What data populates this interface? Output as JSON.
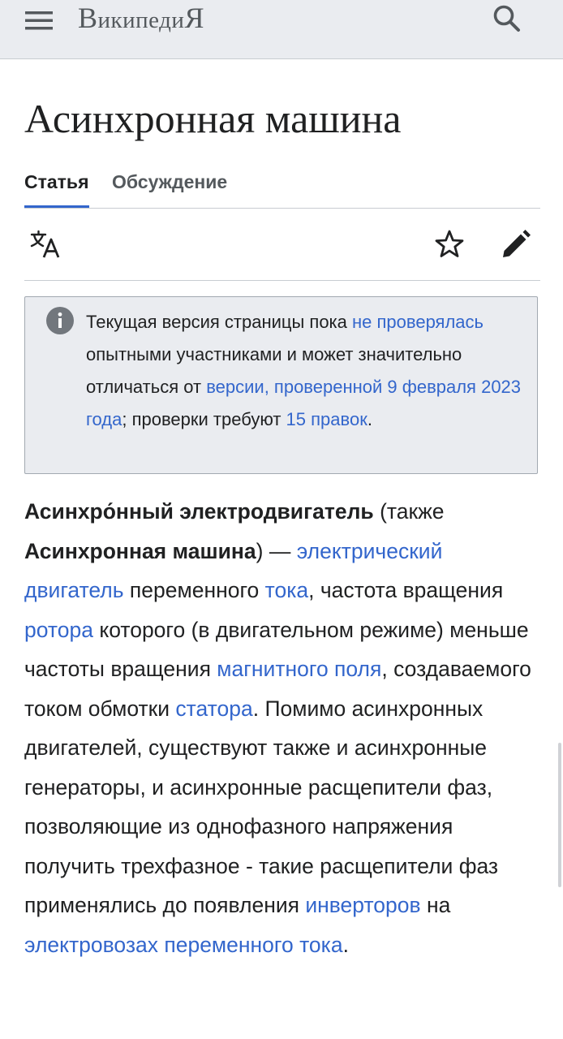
{
  "header": {
    "wordmark": {
      "first": "В",
      "middle": "икипеди",
      "last": "Я"
    },
    "menu_icon": "hamburger-menu-icon",
    "search_icon": "search-icon"
  },
  "page": {
    "title": "Асинхронная машина"
  },
  "tabs": [
    {
      "label": "Статья",
      "active": true
    },
    {
      "label": "Обсуждение",
      "active": false
    }
  ],
  "toolbar": {
    "language_icon": "language-icon",
    "watch_icon": "star-icon",
    "edit_icon": "pencil-icon"
  },
  "notice": {
    "icon": "info-icon",
    "t1": "Текущая версия страницы пока ",
    "l1": "не проверялась",
    "t2": " опытными участниками и может значительно отличаться от ",
    "l2": "версии, проверенной 9 февраля 2023 года",
    "t3": "; проверки требуют ",
    "l3": "15 правок",
    "t4": "."
  },
  "article": {
    "b1": "Асинхро́нный электродвигатель",
    "t1": " (также ",
    "b2": "Асинхронная машина",
    "t2": ") — ",
    "l1": "электрический двигатель",
    "t3": " переменного ",
    "l2": "тока",
    "t4": ", частота вращения ",
    "l3": "ротора",
    "t5": " которого (в двигательном режиме) меньше частоты вращения ",
    "l4": "магнитного поля",
    "t6": ", создаваемого током обмотки ",
    "l5": "статора",
    "t7": ". Помимо асинхронных двигателей, существуют также и асинхронные генераторы, и асинхронные расщепители фаз, позволяющие из однофазного напряжения получить трехфазное - такие расщепители фаз применялись до появления ",
    "l6": "инверторов",
    "t8": " на ",
    "l7": "электровозах переменного тока",
    "t9": "."
  },
  "colors": {
    "link": "#3366cc",
    "header_bg": "#eaecf0",
    "text": "#202122",
    "muted": "#54595d",
    "border": "#c8ccd1"
  }
}
